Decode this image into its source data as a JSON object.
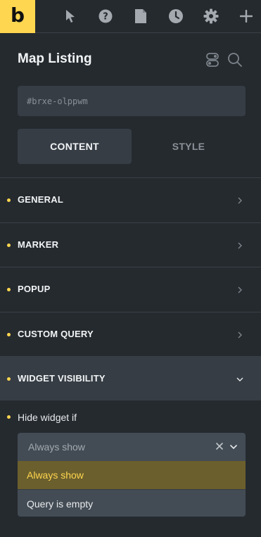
{
  "toolbar": {
    "logo_text": "b",
    "icons": [
      "cursor-icon",
      "help-icon",
      "pages-icon",
      "history-icon",
      "settings-icon",
      "add-icon"
    ]
  },
  "panel": {
    "title": "Map Listing",
    "id_placeholder": "#brxe-olppwm",
    "tabs": {
      "content": "CONTENT",
      "style": "STYLE"
    }
  },
  "sections": [
    {
      "label": "GENERAL"
    },
    {
      "label": "MARKER"
    },
    {
      "label": "POPUP"
    },
    {
      "label": "CUSTOM QUERY"
    },
    {
      "label": "WIDGET VISIBILITY"
    }
  ],
  "visibility": {
    "field_label": "Hide widget if",
    "selected_value": "Always show",
    "options": [
      "Always show",
      "Query is empty"
    ]
  },
  "colors": {
    "accent": "#ffd64f",
    "background": "#252a2f",
    "surface": "#363d45",
    "selected_option": "#6b5f2d"
  }
}
